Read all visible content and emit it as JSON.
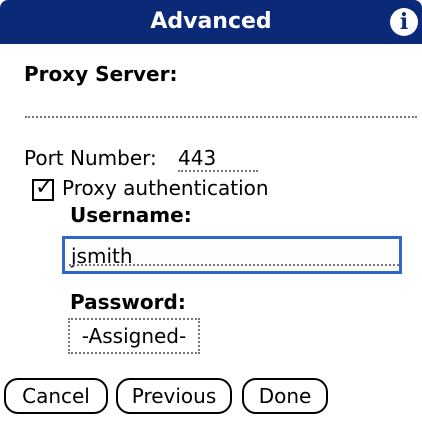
{
  "window": {
    "title": "Advanced",
    "info_icon": "info-icon"
  },
  "form": {
    "proxy_server_label": "Proxy Server:",
    "port_number_label": "Port Number:",
    "port_number_value": "443",
    "proxy_auth_label": "Proxy authentication",
    "proxy_auth_checked": true,
    "username_label": "Username:",
    "username_value": "jsmith",
    "password_label": "Password:",
    "password_value": "-Assigned-"
  },
  "buttons": {
    "cancel": "Cancel",
    "previous": "Previous",
    "done": "Done"
  },
  "colors": {
    "title_bar": "#0a2a78",
    "input_focus_border": "#2e66d0"
  }
}
